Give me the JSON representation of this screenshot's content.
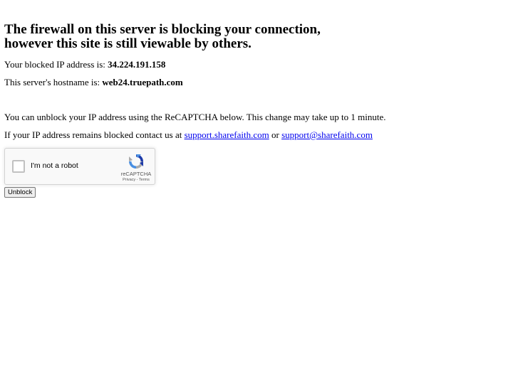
{
  "heading": {
    "line1": "The firewall on this server is blocking your connection,",
    "line2": "however this site is still viewable by others."
  },
  "blocked_ip": {
    "label": "Your blocked IP address is: ",
    "value": "34.224.191.158"
  },
  "hostname": {
    "label": "This server's hostname is: ",
    "value": "web24.truepath.com"
  },
  "unblock_info": "You can unblock your IP address using the ReCAPTCHA below. This change may take up to 1 minute.",
  "contact": {
    "prefix": "If your IP address remains blocked contact us at ",
    "link1": "support.sharefaith.com",
    "separator": " or ",
    "link2": "support@sharefaith.com"
  },
  "recaptcha": {
    "label": "I'm not a robot",
    "brand": "reCAPTCHA",
    "privacy": "Privacy",
    "terms_sep": " - ",
    "terms": "Terms",
    "logo_icon": "recaptcha-logo-icon"
  },
  "unblock_button": "Unblock",
  "colors": {
    "link": "#0000ee",
    "recaptcha_blue": "#1c3aa9",
    "recaptcha_light": "#4a90e2"
  }
}
